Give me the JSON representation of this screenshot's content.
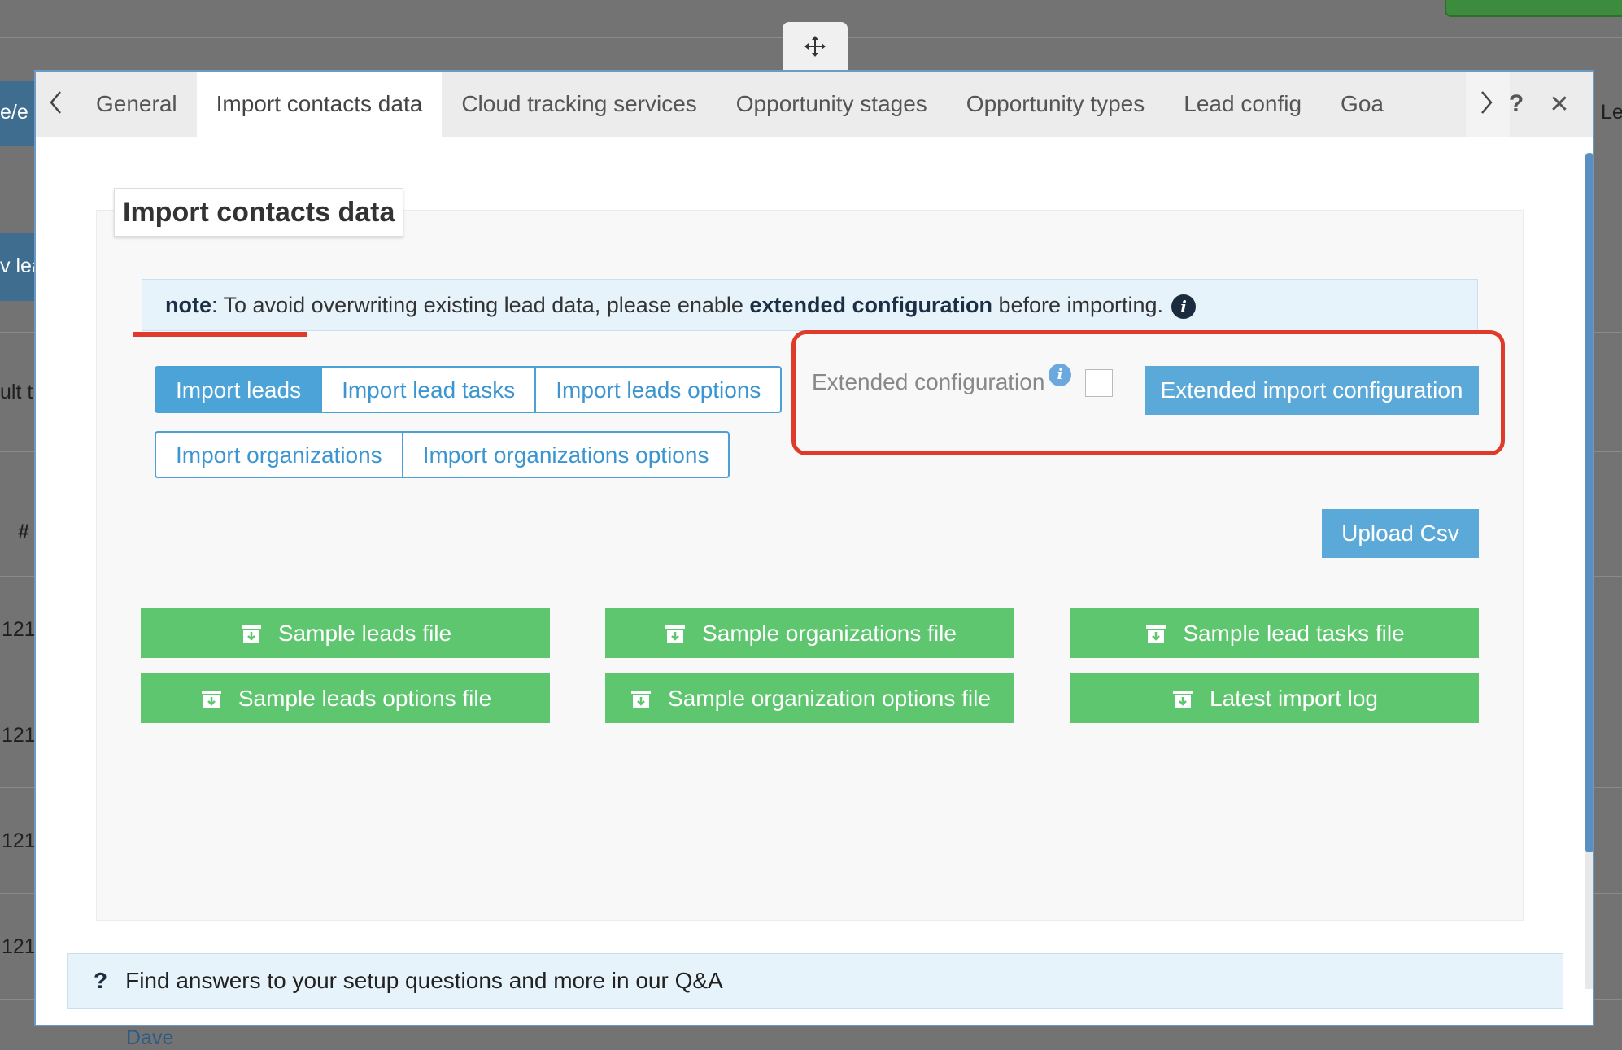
{
  "background": {
    "fragments": [
      "e/e",
      "v lea",
      "ult t",
      "#",
      "121",
      "121",
      "121",
      "121",
      "Le",
      "Dave"
    ]
  },
  "tabs": {
    "prev_icon": "chevron-left-icon",
    "next_icon": "chevron-right-icon",
    "items": [
      {
        "label": "General"
      },
      {
        "label": "Import contacts data",
        "active": true
      },
      {
        "label": "Cloud tracking services"
      },
      {
        "label": "Opportunity stages"
      },
      {
        "label": "Opportunity types"
      },
      {
        "label": "Lead config"
      },
      {
        "label": "Goa"
      }
    ],
    "help_label": "?",
    "close_label": "✕"
  },
  "section": {
    "title": "Import contacts data"
  },
  "note": {
    "prefix": "note",
    "text_before": ": To avoid overwriting existing lead data, please enable ",
    "bold": "extended configuration",
    "text_after": " before importing.",
    "info_icon": "info-icon"
  },
  "import_buttons": {
    "row1": [
      "Import leads",
      "Import lead tasks",
      "Import leads options"
    ],
    "row2": [
      "Import organizations",
      "Import organizations options"
    ],
    "active": "Import leads"
  },
  "extended": {
    "label": "Extended configuration",
    "checked": false,
    "button": "Extended import configuration"
  },
  "upload": {
    "label": "Upload Csv"
  },
  "downloads": {
    "icon": "download-box-icon",
    "items": [
      "Sample leads file",
      "Sample organizations file",
      "Sample lead tasks file",
      "Sample leads options file",
      "Sample organization options file",
      "Latest import log"
    ]
  },
  "qa": {
    "icon": "?",
    "text": "Find answers to your setup questions and more in our Q&A"
  },
  "colors": {
    "accent_blue": "#4ba3d7",
    "green": "#5ec66f",
    "highlight_red": "#e03a2a"
  }
}
